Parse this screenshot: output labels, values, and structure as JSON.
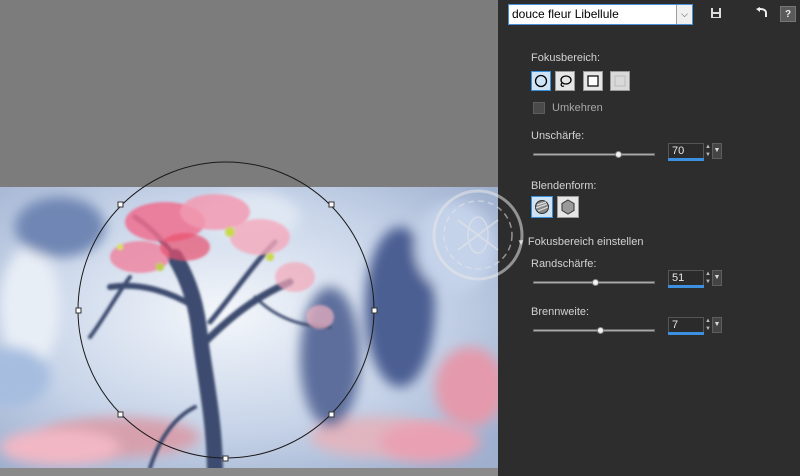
{
  "toolbar": {
    "preset_value": "douce fleur Libellule",
    "save_icon": "save-icon",
    "reset_icon": "reset-icon",
    "help_label": "?"
  },
  "focus": {
    "label": "Fokusbereich:",
    "shapes": [
      "ellipse-icon",
      "lasso-icon",
      "rectangle-icon",
      "clear-icon"
    ],
    "invert_label": "Umkehren",
    "invert_checked": false
  },
  "blur": {
    "label": "Unschärfe:",
    "value": "70",
    "level_percent": 70
  },
  "aperture": {
    "label": "Blendenform:",
    "shapes": [
      "circle-aperture-icon",
      "hexagon-aperture-icon"
    ]
  },
  "section": {
    "label": "Fokusbereich einstellen"
  },
  "edge": {
    "label": "Randschärfe:",
    "value": "51",
    "level_percent": 51
  },
  "focal": {
    "label": "Brennweite:",
    "value": "7",
    "level_percent": 55
  },
  "colors": {
    "panel_bg": "#2d2d2d",
    "accent": "#3d8fe0",
    "canvas_bg": "#7c7c7c"
  }
}
